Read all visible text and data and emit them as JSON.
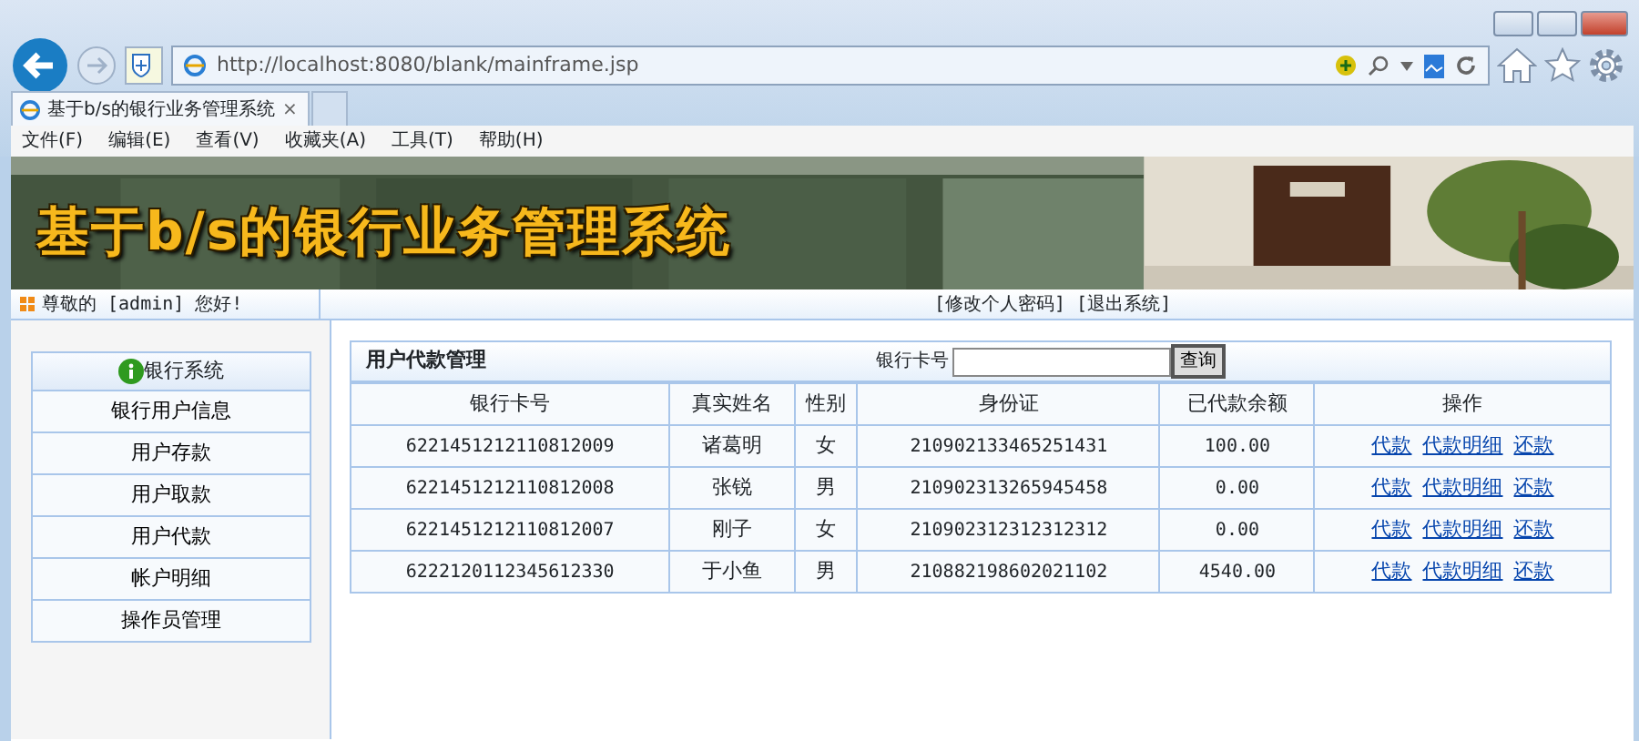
{
  "browser": {
    "url": "http://localhost:8080/blank/mainframe.jsp",
    "tab_title": "基于b/s的银行业务管理系统",
    "tab_close": "×",
    "menu": [
      "文件(F)",
      "编辑(E)",
      "查看(V)",
      "收藏夹(A)",
      "工具(T)",
      "帮助(H)"
    ]
  },
  "banner": {
    "title": "基于b/s的银行业务管理系统"
  },
  "greeting": "尊敬的 [admin] 您好!",
  "top_links": [
    "[修改个人密码]",
    "[退出系统]"
  ],
  "sidebar": {
    "header": "银行系统",
    "items": [
      {
        "label": "银行用户信息",
        "selected": false
      },
      {
        "label": "用户存款",
        "selected": false
      },
      {
        "label": "用户取款",
        "selected": false
      },
      {
        "label": "用户代款",
        "selected": false
      },
      {
        "label": "帐户明细",
        "selected": false
      },
      {
        "label": "操作员管理",
        "selected": false
      }
    ]
  },
  "panel": {
    "title": "用户代款管理",
    "search_label": "银行卡号",
    "search_button": "查询"
  },
  "table": {
    "columns": [
      "银行卡号",
      "真实姓名",
      "性别",
      "身份证",
      "已代款余额",
      "操作"
    ],
    "rows": [
      {
        "card": "6221451212110812009",
        "name": "诸葛明",
        "gender": "女",
        "id": "210902133465251431",
        "balance": "100.00",
        "actions": [
          "代款",
          "代款明细",
          "还款"
        ]
      },
      {
        "card": "6221451212110812008",
        "name": "张锐",
        "gender": "男",
        "id": "210902313265945458",
        "balance": "0.00",
        "actions": [
          "代款",
          "代款明细",
          "还款"
        ]
      },
      {
        "card": "6221451212110812007",
        "name": "刚子",
        "gender": "女",
        "id": "210902312312312312",
        "balance": "0.00",
        "actions": [
          "代款",
          "代款明细",
          "还款"
        ]
      },
      {
        "card": "6222120112345612330",
        "name": "于小鱼",
        "gender": "男",
        "id": "210882198602021102",
        "balance": "4540.00",
        "actions": [
          "代款",
          "代款明细",
          "还款"
        ]
      }
    ]
  }
}
